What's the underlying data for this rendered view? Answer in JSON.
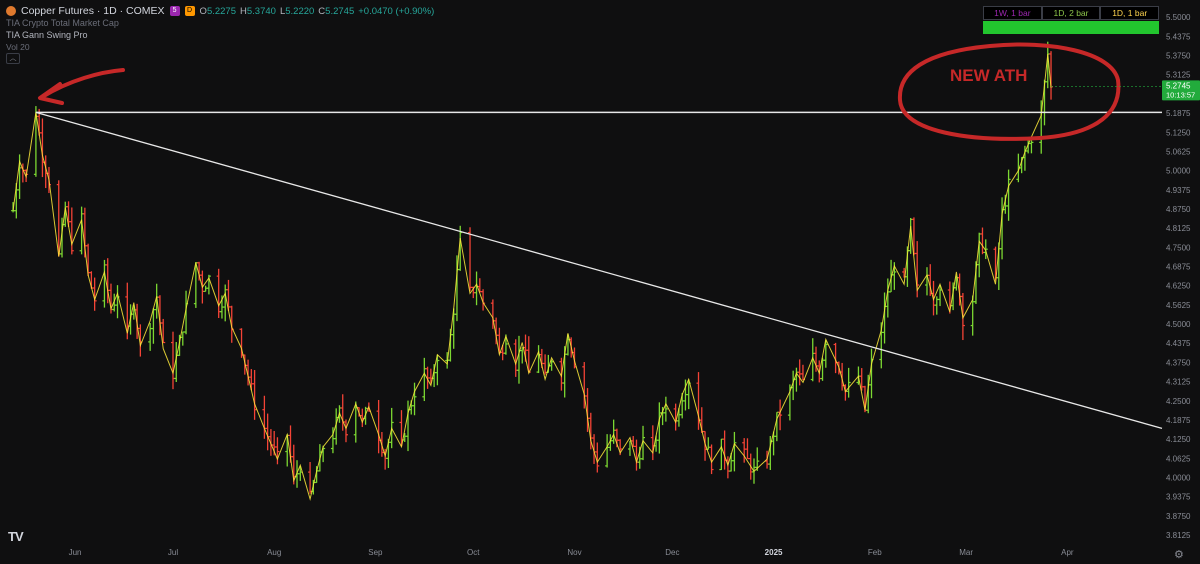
{
  "header": {
    "symbol": "Copper Futures · 1D · COMEX",
    "badges": [
      "5",
      "D"
    ],
    "ohlc": [
      {
        "k": "O",
        "v": "5.2275"
      },
      {
        "k": "H",
        "v": "5.3740"
      },
      {
        "k": "L",
        "v": "5.2220"
      },
      {
        "k": "C",
        "v": "5.2745"
      },
      {
        "k": "",
        "v": "+0.0470 (+0.90%)"
      }
    ],
    "indicator1": "TIA Crypto Total Market Cap",
    "indicator2": "TIA Gann Swing Pro",
    "volume": "Vol 20"
  },
  "timeframes": [
    {
      "label": "1W, 1 bar",
      "color": "#9c27b0"
    },
    {
      "label": "1D, 2 bar",
      "color": "#8bc34a"
    },
    {
      "label": "1D, 1 bar",
      "color": "#ffd54f"
    }
  ],
  "price_tag": {
    "price": "5.2745",
    "countdown": "10:13:57",
    "color": "#22ab3c"
  },
  "annotation": {
    "text": "NEW ATH",
    "color": "#c62828"
  },
  "colors": {
    "up": "#7cd832",
    "down": "#f44336",
    "swing": "#ffeb3b",
    "line": "#e8e8e8"
  },
  "chart_data": {
    "type": "ohlc",
    "title": "Copper Futures · 1D · COMEX",
    "y_ticks": [
      "5.5000",
      "5.4375",
      "5.3750",
      "5.3125",
      "5.2500",
      "5.1875",
      "5.1250",
      "5.0625",
      "5.0000",
      "4.9375",
      "4.8750",
      "4.8125",
      "4.7500",
      "4.6875",
      "4.6250",
      "4.5625",
      "4.5000",
      "4.4375",
      "4.3750",
      "4.3125",
      "4.2500",
      "4.1875",
      "4.1250",
      "4.0625",
      "4.0000",
      "3.9375",
      "3.8750",
      "3.8125"
    ],
    "ylim": [
      3.78,
      5.53
    ],
    "x_ticks": [
      {
        "label": "Jun",
        "date": "2024-06-01"
      },
      {
        "label": "Jul",
        "date": "2024-07-01"
      },
      {
        "label": "Aug",
        "date": "2024-08-01"
      },
      {
        "label": "Sep",
        "date": "2024-09-01"
      },
      {
        "label": "Oct",
        "date": "2024-10-01"
      },
      {
        "label": "Nov",
        "date": "2024-11-01"
      },
      {
        "label": "Dec",
        "date": "2024-12-01"
      },
      {
        "label": "2025",
        "date": "2025-01-01"
      },
      {
        "label": "Feb",
        "date": "2025-02-01"
      },
      {
        "label": "Mar",
        "date": "2025-03-01"
      },
      {
        "label": "Apr",
        "date": "2025-04-01"
      }
    ],
    "xlim": [
      "2024-05-09",
      "2025-04-30"
    ],
    "close_path": [
      {
        "x": "2024-05-13",
        "y": 4.87
      },
      {
        "x": "2024-05-15",
        "y": 5.03
      },
      {
        "x": "2024-05-17",
        "y": 4.98
      },
      {
        "x": "2024-05-20",
        "y": 5.19
      },
      {
        "x": "2024-05-22",
        "y": 5.05
      },
      {
        "x": "2024-05-24",
        "y": 4.97
      },
      {
        "x": "2024-05-27",
        "y": 4.72
      },
      {
        "x": "2024-05-29",
        "y": 4.88
      },
      {
        "x": "2024-05-31",
        "y": 4.76
      },
      {
        "x": "2024-06-03",
        "y": 4.84
      },
      {
        "x": "2024-06-05",
        "y": 4.66
      },
      {
        "x": "2024-06-07",
        "y": 4.58
      },
      {
        "x": "2024-06-10",
        "y": 4.67
      },
      {
        "x": "2024-06-12",
        "y": 4.55
      },
      {
        "x": "2024-06-14",
        "y": 4.6
      },
      {
        "x": "2024-06-17",
        "y": 4.47
      },
      {
        "x": "2024-06-19",
        "y": 4.57
      },
      {
        "x": "2024-06-21",
        "y": 4.43
      },
      {
        "x": "2024-06-24",
        "y": 4.51
      },
      {
        "x": "2024-06-26",
        "y": 4.59
      },
      {
        "x": "2024-06-28",
        "y": 4.42
      },
      {
        "x": "2024-07-01",
        "y": 4.34
      },
      {
        "x": "2024-07-03",
        "y": 4.44
      },
      {
        "x": "2024-07-05",
        "y": 4.55
      },
      {
        "x": "2024-07-08",
        "y": 4.7
      },
      {
        "x": "2024-07-10",
        "y": 4.62
      },
      {
        "x": "2024-07-12",
        "y": 4.65
      },
      {
        "x": "2024-07-15",
        "y": 4.56
      },
      {
        "x": "2024-07-17",
        "y": 4.6
      },
      {
        "x": "2024-07-19",
        "y": 4.49
      },
      {
        "x": "2024-07-22",
        "y": 4.42
      },
      {
        "x": "2024-07-24",
        "y": 4.33
      },
      {
        "x": "2024-07-26",
        "y": 4.24
      },
      {
        "x": "2024-07-29",
        "y": 4.16
      },
      {
        "x": "2024-07-31",
        "y": 4.11
      },
      {
        "x": "2024-08-02",
        "y": 4.06
      },
      {
        "x": "2024-08-05",
        "y": 4.14
      },
      {
        "x": "2024-08-07",
        "y": 3.99
      },
      {
        "x": "2024-08-09",
        "y": 4.04
      },
      {
        "x": "2024-08-12",
        "y": 3.93
      },
      {
        "x": "2024-08-14",
        "y": 4.02
      },
      {
        "x": "2024-08-16",
        "y": 4.1
      },
      {
        "x": "2024-08-19",
        "y": 4.14
      },
      {
        "x": "2024-08-21",
        "y": 4.21
      },
      {
        "x": "2024-08-23",
        "y": 4.16
      },
      {
        "x": "2024-08-26",
        "y": 4.24
      },
      {
        "x": "2024-08-28",
        "y": 4.18
      },
      {
        "x": "2024-08-30",
        "y": 4.23
      },
      {
        "x": "2024-09-02",
        "y": 4.14
      },
      {
        "x": "2024-09-04",
        "y": 4.07
      },
      {
        "x": "2024-09-06",
        "y": 4.16
      },
      {
        "x": "2024-09-09",
        "y": 4.1
      },
      {
        "x": "2024-09-11",
        "y": 4.21
      },
      {
        "x": "2024-09-13",
        "y": 4.28
      },
      {
        "x": "2024-09-16",
        "y": 4.34
      },
      {
        "x": "2024-09-18",
        "y": 4.3
      },
      {
        "x": "2024-09-20",
        "y": 4.4
      },
      {
        "x": "2024-09-23",
        "y": 4.37
      },
      {
        "x": "2024-09-25",
        "y": 4.55
      },
      {
        "x": "2024-09-27",
        "y": 4.78
      },
      {
        "x": "2024-09-30",
        "y": 4.6
      },
      {
        "x": "2024-10-02",
        "y": 4.63
      },
      {
        "x": "2024-10-04",
        "y": 4.57
      },
      {
        "x": "2024-10-07",
        "y": 4.52
      },
      {
        "x": "2024-10-09",
        "y": 4.4
      },
      {
        "x": "2024-10-11",
        "y": 4.46
      },
      {
        "x": "2024-10-14",
        "y": 4.37
      },
      {
        "x": "2024-10-16",
        "y": 4.44
      },
      {
        "x": "2024-10-18",
        "y": 4.34
      },
      {
        "x": "2024-10-21",
        "y": 4.41
      },
      {
        "x": "2024-10-23",
        "y": 4.32
      },
      {
        "x": "2024-10-25",
        "y": 4.39
      },
      {
        "x": "2024-10-28",
        "y": 4.33
      },
      {
        "x": "2024-10-30",
        "y": 4.47
      },
      {
        "x": "2024-11-01",
        "y": 4.38
      },
      {
        "x": "2024-11-04",
        "y": 4.27
      },
      {
        "x": "2024-11-06",
        "y": 4.12
      },
      {
        "x": "2024-11-08",
        "y": 4.05
      },
      {
        "x": "2024-11-11",
        "y": 4.1
      },
      {
        "x": "2024-11-13",
        "y": 4.14
      },
      {
        "x": "2024-11-15",
        "y": 4.08
      },
      {
        "x": "2024-11-18",
        "y": 4.13
      },
      {
        "x": "2024-11-20",
        "y": 4.05
      },
      {
        "x": "2024-11-22",
        "y": 4.12
      },
      {
        "x": "2024-11-25",
        "y": 4.08
      },
      {
        "x": "2024-11-27",
        "y": 4.19
      },
      {
        "x": "2024-11-29",
        "y": 4.24
      },
      {
        "x": "2024-12-02",
        "y": 4.18
      },
      {
        "x": "2024-12-04",
        "y": 4.27
      },
      {
        "x": "2024-12-06",
        "y": 4.32
      },
      {
        "x": "2024-12-09",
        "y": 4.2
      },
      {
        "x": "2024-12-11",
        "y": 4.11
      },
      {
        "x": "2024-12-13",
        "y": 4.05
      },
      {
        "x": "2024-12-16",
        "y": 4.1
      },
      {
        "x": "2024-12-18",
        "y": 4.04
      },
      {
        "x": "2024-12-20",
        "y": 4.11
      },
      {
        "x": "2024-12-23",
        "y": 4.07
      },
      {
        "x": "2024-12-26",
        "y": 4.02
      },
      {
        "x": "2024-12-30",
        "y": 4.06
      },
      {
        "x": "2025-01-02",
        "y": 4.19
      },
      {
        "x": "2025-01-06",
        "y": 4.28
      },
      {
        "x": "2025-01-08",
        "y": 4.34
      },
      {
        "x": "2025-01-10",
        "y": 4.31
      },
      {
        "x": "2025-01-13",
        "y": 4.39
      },
      {
        "x": "2025-01-15",
        "y": 4.34
      },
      {
        "x": "2025-01-17",
        "y": 4.45
      },
      {
        "x": "2025-01-21",
        "y": 4.36
      },
      {
        "x": "2025-01-23",
        "y": 4.28
      },
      {
        "x": "2025-01-27",
        "y": 4.33
      },
      {
        "x": "2025-01-29",
        "y": 4.22
      },
      {
        "x": "2025-01-31",
        "y": 4.37
      },
      {
        "x": "2025-02-03",
        "y": 4.48
      },
      {
        "x": "2025-02-05",
        "y": 4.61
      },
      {
        "x": "2025-02-07",
        "y": 4.69
      },
      {
        "x": "2025-02-10",
        "y": 4.63
      },
      {
        "x": "2025-02-12",
        "y": 4.82
      },
      {
        "x": "2025-02-14",
        "y": 4.61
      },
      {
        "x": "2025-02-17",
        "y": 4.66
      },
      {
        "x": "2025-02-19",
        "y": 4.58
      },
      {
        "x": "2025-02-21",
        "y": 4.63
      },
      {
        "x": "2025-02-24",
        "y": 4.54
      },
      {
        "x": "2025-02-26",
        "y": 4.67
      },
      {
        "x": "2025-02-28",
        "y": 4.52
      },
      {
        "x": "2025-03-03",
        "y": 4.58
      },
      {
        "x": "2025-03-05",
        "y": 4.77
      },
      {
        "x": "2025-03-07",
        "y": 4.74
      },
      {
        "x": "2025-03-10",
        "y": 4.63
      },
      {
        "x": "2025-03-12",
        "y": 4.86
      },
      {
        "x": "2025-03-14",
        "y": 4.95
      },
      {
        "x": "2025-03-17",
        "y": 5.0
      },
      {
        "x": "2025-03-19",
        "y": 5.06
      },
      {
        "x": "2025-03-21",
        "y": 5.11
      },
      {
        "x": "2025-03-24",
        "y": 5.18
      },
      {
        "x": "2025-03-26",
        "y": 5.38
      },
      {
        "x": "2025-03-27",
        "y": 5.27
      }
    ],
    "horizontal_line": {
      "y": 5.19,
      "from": "2024-05-20"
    },
    "trend_line": {
      "from": {
        "x": "2024-05-20",
        "y": 5.19
      },
      "to": {
        "x": "2025-04-30",
        "y": 4.16
      }
    }
  }
}
